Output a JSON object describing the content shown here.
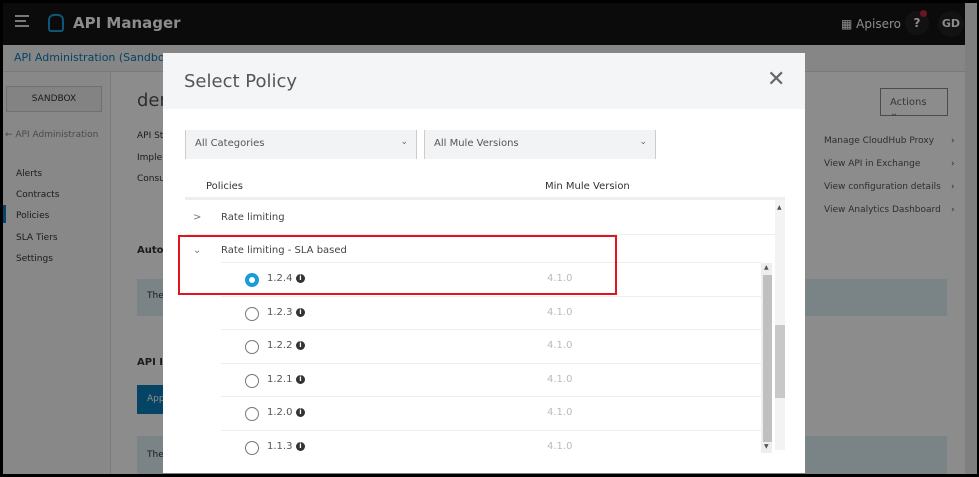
{
  "topbar": {
    "title": "API Manager",
    "org": "Apisero",
    "help": "?",
    "avatar": "GD"
  },
  "breadcrumb": "API Administration (Sandbox)",
  "sidebar": {
    "env": "SANDBOX",
    "back": "← API Administration",
    "items": [
      "Alerts",
      "Contracts",
      "Policies",
      "SLA Tiers",
      "Settings"
    ],
    "selected": "Policies"
  },
  "background": {
    "title": "den",
    "fields": [
      "API St",
      "Imple",
      "Consu"
    ],
    "section1": "Auto",
    "banner1": "The",
    "section2": "API I",
    "button": "App",
    "banner2": "The",
    "actions": "Actions",
    "links": [
      "Manage CloudHub Proxy",
      "View API in Exchange",
      "View configuration details",
      "View Analytics Dashboard"
    ]
  },
  "modal": {
    "title": "Select Policy",
    "category_select": "All Categories",
    "version_select": "All Mule Versions",
    "col_policies": "Policies",
    "col_min_version": "Min Mule Version",
    "policies": [
      {
        "name": "Rate limiting",
        "expanded": false
      },
      {
        "name": "Rate limiting - SLA based",
        "expanded": true
      }
    ],
    "versions": [
      {
        "version": "1.2.4",
        "min": "4.1.0",
        "selected": true
      },
      {
        "version": "1.2.3",
        "min": "4.1.0",
        "selected": false
      },
      {
        "version": "1.2.2",
        "min": "4.1.0",
        "selected": false
      },
      {
        "version": "1.2.1",
        "min": "4.1.0",
        "selected": false
      },
      {
        "version": "1.2.0",
        "min": "4.1.0",
        "selected": false
      },
      {
        "version": "1.1.3",
        "min": "4.1.0",
        "selected": false
      }
    ]
  },
  "colors": {
    "accent": "#1b9bd7",
    "highlight": "#e0141e"
  }
}
